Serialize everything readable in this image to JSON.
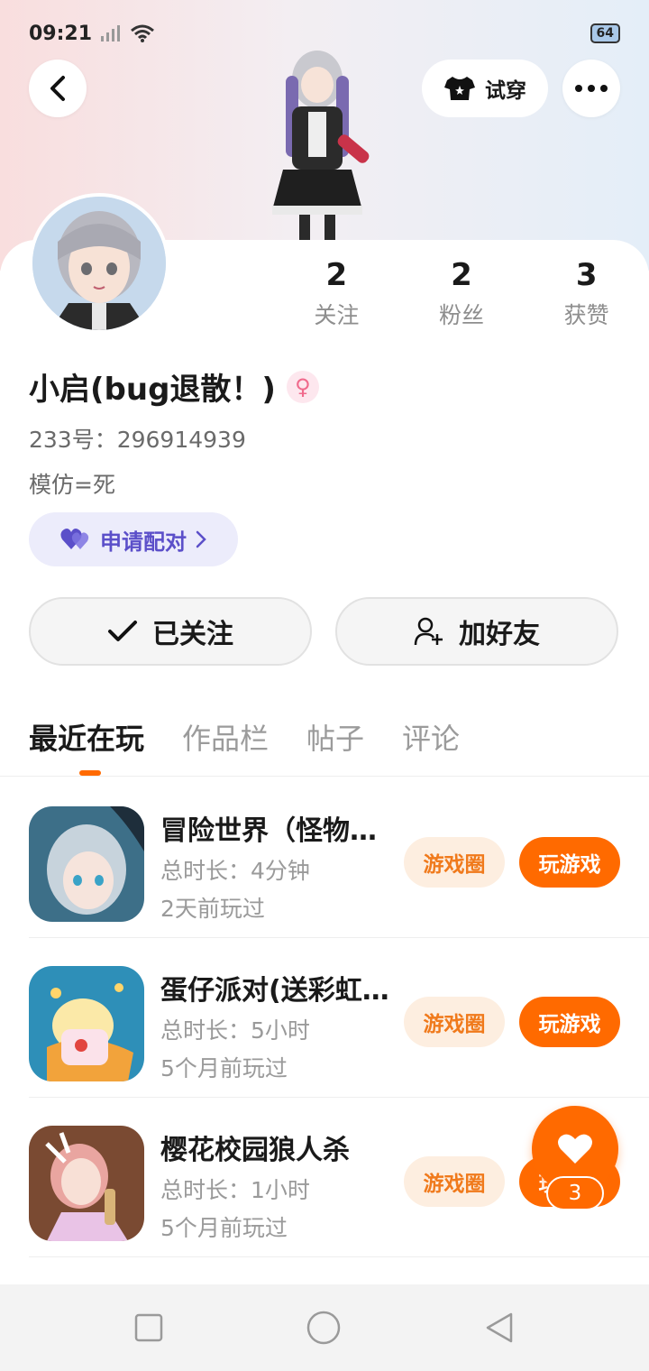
{
  "status_bar": {
    "time": "09:21",
    "battery": "64"
  },
  "header": {
    "tryon_label": "试穿"
  },
  "stats": [
    {
      "value": "2",
      "label": "关注"
    },
    {
      "value": "2",
      "label": "粉丝"
    },
    {
      "value": "3",
      "label": "获赞"
    }
  ],
  "profile": {
    "name": "小启(bug退散！)",
    "gender_symbol": "♀",
    "uid": "233号：296914939",
    "bio": "模仿=死",
    "pair_label": "申请配对"
  },
  "actions": {
    "followed_label": "已关注",
    "add_friend_label": "加好友"
  },
  "tabs": [
    "最近在玩",
    "作品栏",
    "帖子",
    "评论"
  ],
  "games": [
    {
      "title": "冒险世界（怪物猎人）",
      "duration": "总时长：4分钟",
      "last_played": "2天前玩过",
      "circle_label": "游戏圈",
      "play_label": "玩游戏"
    },
    {
      "title": "蛋仔派对(送彩虹蛋)",
      "duration": "总时长：5小时",
      "last_played": "5个月前玩过",
      "circle_label": "游戏圈",
      "play_label": "玩游戏"
    },
    {
      "title": "樱花校园狼人杀",
      "duration": "总时长：1小时",
      "last_played": "5个月前玩过",
      "circle_label": "游戏圈",
      "play_label": "玩游戏"
    }
  ],
  "fab": {
    "count": "3"
  },
  "colors": {
    "accent": "#ff6a00",
    "pair": "#5b4fc9",
    "gender": "#f06a8c"
  }
}
